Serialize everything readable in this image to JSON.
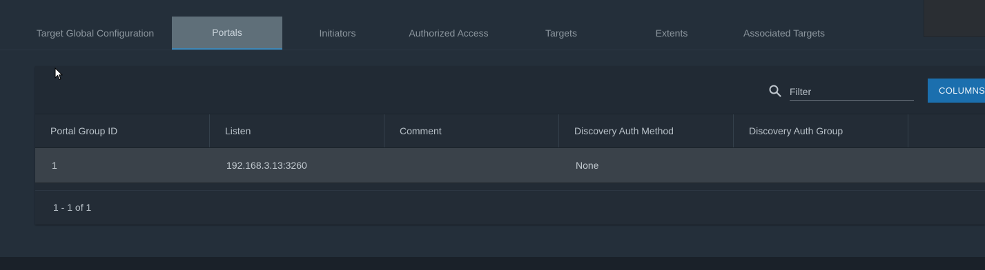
{
  "tabs": [
    {
      "label": "Target Global Configuration"
    },
    {
      "label": "Portals",
      "active": true
    },
    {
      "label": "Initiators"
    },
    {
      "label": "Authorized Access"
    },
    {
      "label": "Targets"
    },
    {
      "label": "Extents"
    },
    {
      "label": "Associated Targets"
    }
  ],
  "toolbar": {
    "filter_placeholder": "Filter",
    "filter_value": "",
    "columns_label": "COLUMNS",
    "search_icon": "search-icon"
  },
  "table": {
    "columns": [
      "Portal Group ID",
      "Listen",
      "Comment",
      "Discovery Auth Method",
      "Discovery Auth Group"
    ],
    "rows": [
      {
        "portal_group_id": "1",
        "listen": "192.168.3.13:3260",
        "comment": "",
        "discovery_auth_method": "None",
        "discovery_auth_group": ""
      }
    ]
  },
  "pagination": {
    "summary": "1 - 1 of 1"
  },
  "colors": {
    "accent": "#1b6fae",
    "active_tab": "#5f6f79",
    "background": "#242f3a"
  }
}
